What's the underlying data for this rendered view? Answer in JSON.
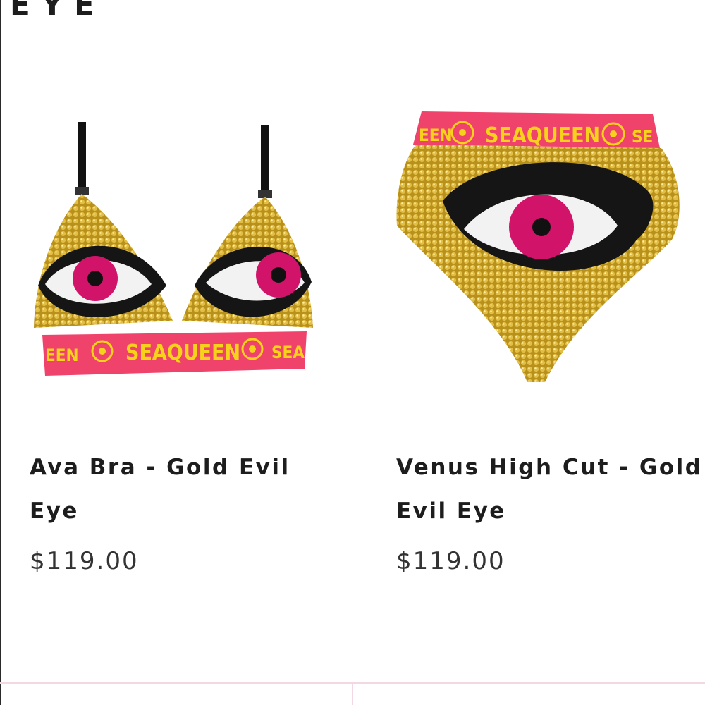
{
  "collection": {
    "title": "EYE"
  },
  "products": [
    {
      "name": "Ava Bra - Gold Evil Eye",
      "name_line1": "Ava Bra - Gold Evil",
      "name_line2": "Eye",
      "price": "$119.00",
      "image_alt": "Ava Bra - Gold Evil Eye"
    },
    {
      "name": "Venus High Cut - Gold Evil Eye",
      "name_line1": "Venus High Cut - Gold",
      "name_line2": "Evil Eye",
      "price": "$119.00",
      "image_alt": "Venus High Cut - Gold Evil Eye"
    }
  ],
  "colors": {
    "gold": "#c9a227",
    "band_pink": "#f0436b",
    "band_text": "#f7d21a",
    "iris": "#d1136a",
    "text": "#1d1d1d",
    "divider": "#f3d7e2"
  }
}
